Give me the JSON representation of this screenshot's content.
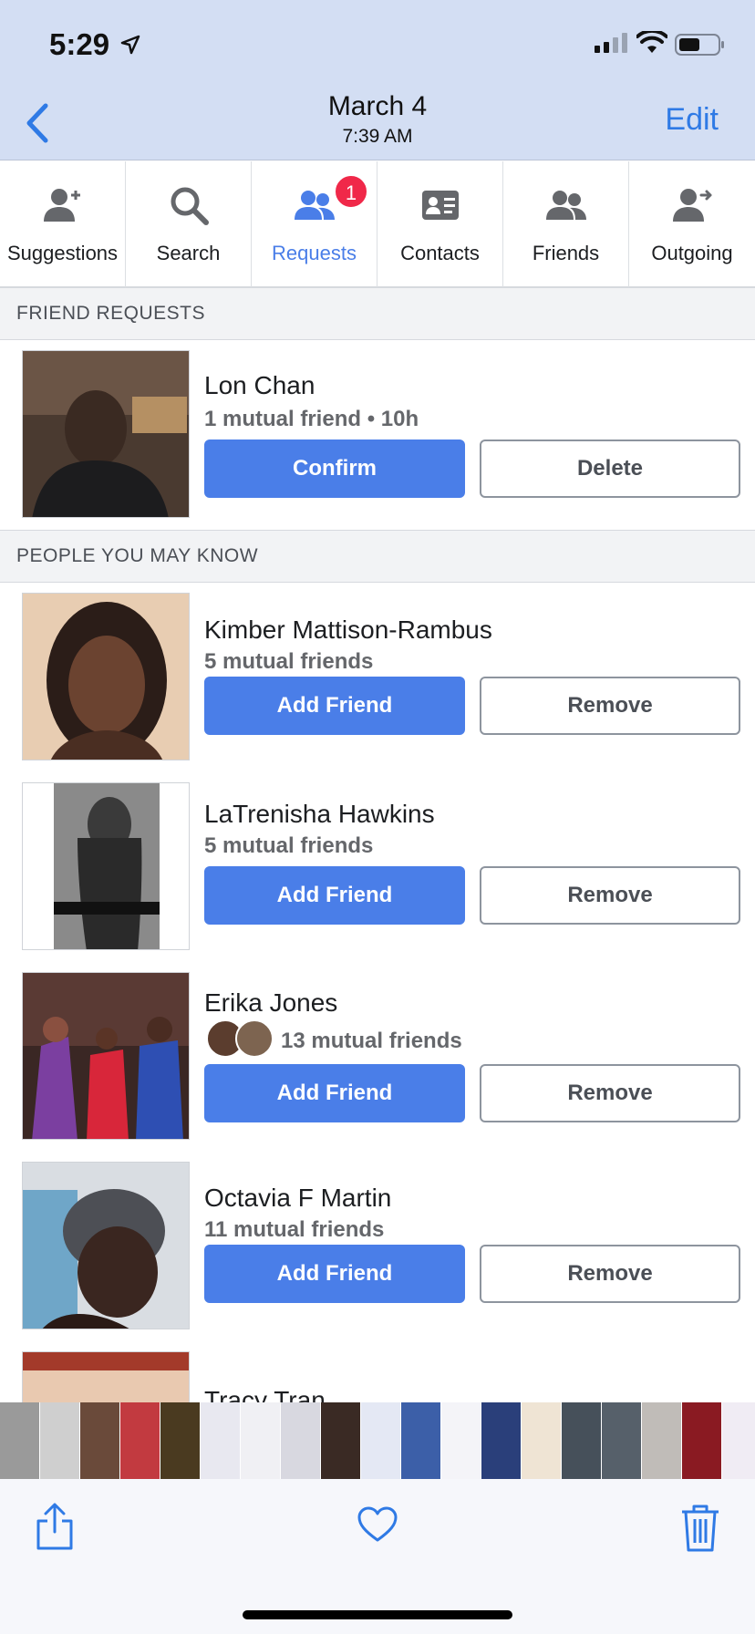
{
  "status_bar": {
    "time": "5:29"
  },
  "photos_header": {
    "date": "March 4",
    "time": "7:39 AM",
    "edit_label": "Edit"
  },
  "tabs": [
    {
      "label": "Suggestions",
      "icon": "add-person-icon"
    },
    {
      "label": "Search",
      "icon": "search-icon"
    },
    {
      "label": "Requests",
      "icon": "people-icon",
      "badge": "1",
      "active": true
    },
    {
      "label": "Contacts",
      "icon": "contact-card-icon"
    },
    {
      "label": "Friends",
      "icon": "friends-icon"
    },
    {
      "label": "Outgoing",
      "icon": "outgoing-person-icon"
    }
  ],
  "friend_requests": {
    "header": "FRIEND REQUESTS",
    "items": [
      {
        "name": "Lon Chan",
        "meta": "1 mutual friend • 10h",
        "primary": "Confirm",
        "secondary": "Delete"
      }
    ]
  },
  "people_you_may_know": {
    "header": "PEOPLE YOU MAY KNOW",
    "items": [
      {
        "name": "Kimber Mattison-Rambus",
        "meta": "5 mutual friends",
        "primary": "Add Friend",
        "secondary": "Remove"
      },
      {
        "name": "LaTrenisha Hawkins",
        "meta": "5 mutual friends",
        "primary": "Add Friend",
        "secondary": "Remove"
      },
      {
        "name": "Erika Jones",
        "meta": "13 mutual friends",
        "primary": "Add Friend",
        "secondary": "Remove"
      },
      {
        "name": "Octavia F Martin",
        "meta": "11 mutual friends",
        "primary": "Add Friend",
        "secondary": "Remove"
      },
      {
        "name": "Tracy Tran",
        "meta": "",
        "primary": "",
        "secondary": ""
      }
    ]
  },
  "colors": {
    "accent": "#4a7ee8",
    "header_bg": "#d3def3",
    "badge": "#f02849",
    "ios_blue": "#2f7ae5"
  }
}
